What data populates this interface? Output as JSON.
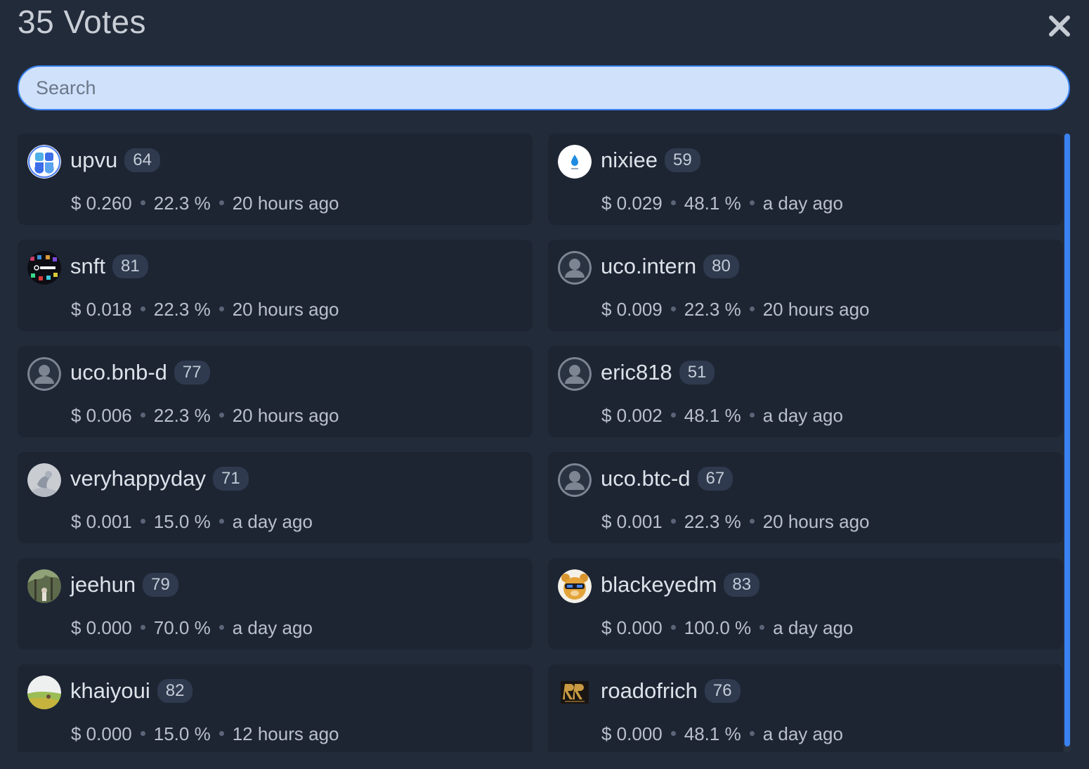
{
  "header": {
    "title": "35 Votes"
  },
  "search": {
    "placeholder": "Search",
    "value": ""
  },
  "colors": {
    "background": "#222b3a",
    "card": "#1d2533",
    "accent": "#3a82f2",
    "search_bg": "#cfe1fb"
  },
  "votes": [
    {
      "name": "upvu",
      "rep": "64",
      "value": "$ 0.260",
      "percent": "22.3 %",
      "time": "20 hours ago",
      "avatar": "upvu-logo-icon"
    },
    {
      "name": "nixiee",
      "rep": "59",
      "value": "$ 0.029",
      "percent": "48.1 %",
      "time": "a day ago",
      "avatar": "water-drop-icon"
    },
    {
      "name": "snft",
      "rep": "81",
      "value": "$ 0.018",
      "percent": "22.3 %",
      "time": "20 hours ago",
      "avatar": "snft-logo-icon"
    },
    {
      "name": "uco.intern",
      "rep": "80",
      "value": "$ 0.009",
      "percent": "22.3 %",
      "time": "20 hours ago",
      "avatar": "default-user-icon"
    },
    {
      "name": "uco.bnb-d",
      "rep": "77",
      "value": "$ 0.006",
      "percent": "22.3 %",
      "time": "20 hours ago",
      "avatar": "default-user-icon"
    },
    {
      "name": "eric818",
      "rep": "51",
      "value": "$ 0.002",
      "percent": "48.1 %",
      "time": "a day ago",
      "avatar": "default-user-icon"
    },
    {
      "name": "veryhappyday",
      "rep": "71",
      "value": "$ 0.001",
      "percent": "15.0 %",
      "time": "a day ago",
      "avatar": "sketch-photo-icon"
    },
    {
      "name": "uco.btc-d",
      "rep": "67",
      "value": "$ 0.001",
      "percent": "22.3 %",
      "time": "20 hours ago",
      "avatar": "default-user-icon"
    },
    {
      "name": "jeehun",
      "rep": "79",
      "value": "$ 0.000",
      "percent": "70.0 %",
      "time": "a day ago",
      "avatar": "forest-photo-icon"
    },
    {
      "name": "blackeyedm",
      "rep": "83",
      "value": "$ 0.000",
      "percent": "100.0 %",
      "time": "a day ago",
      "avatar": "cartoon-bear-icon"
    },
    {
      "name": "khaiyoui",
      "rep": "82",
      "value": "$ 0.000",
      "percent": "15.0 %",
      "time": "12 hours ago",
      "avatar": "field-photo-icon"
    },
    {
      "name": "roadofrich",
      "rep": "76",
      "value": "$ 0.000",
      "percent": "48.1 %",
      "time": "a day ago",
      "avatar": "rr-logo-icon"
    }
  ]
}
